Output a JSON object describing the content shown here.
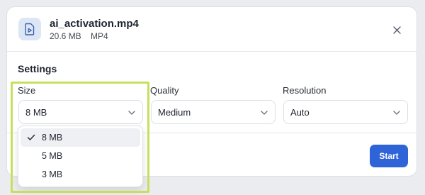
{
  "file": {
    "name": "ai_activation.mp4",
    "size": "20.6 MB",
    "format": "MP4",
    "icon": "video-file-icon"
  },
  "settings": {
    "title": "Settings",
    "size": {
      "label": "Size",
      "value": "8 MB",
      "options": [
        "8 MB",
        "5 MB",
        "3 MB"
      ],
      "selected_index": 0
    },
    "quality": {
      "label": "Quality",
      "value": "Medium"
    },
    "resolution": {
      "label": "Resolution",
      "value": "Auto"
    }
  },
  "actions": {
    "start_label": "Start"
  },
  "colors": {
    "accent": "#2f63d8",
    "highlight": "#c5e05f",
    "icon_bg": "#dde6f4"
  }
}
